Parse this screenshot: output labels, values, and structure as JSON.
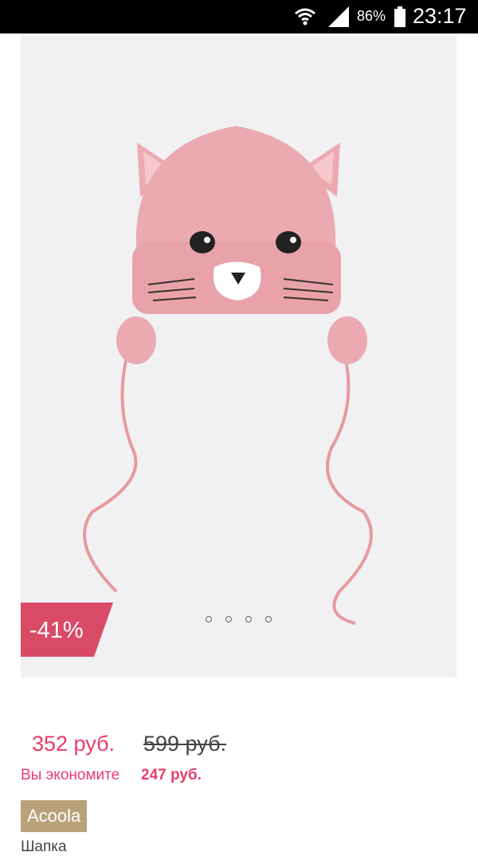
{
  "status_bar": {
    "battery_percent": "86%",
    "time": "23:17"
  },
  "product": {
    "discount_badge": "-41%",
    "gallery": {
      "image_count": 4,
      "active_index": 0
    },
    "price_current": "352 руб.",
    "price_old": "599 руб.",
    "savings_label": "Вы экономите",
    "savings_amount": "247 руб.",
    "brand": "Acoola",
    "name": "Шапка"
  },
  "colors": {
    "accent": "#e83c6c",
    "badge": "#d94a67",
    "brand_tag": "#b9a27a"
  }
}
